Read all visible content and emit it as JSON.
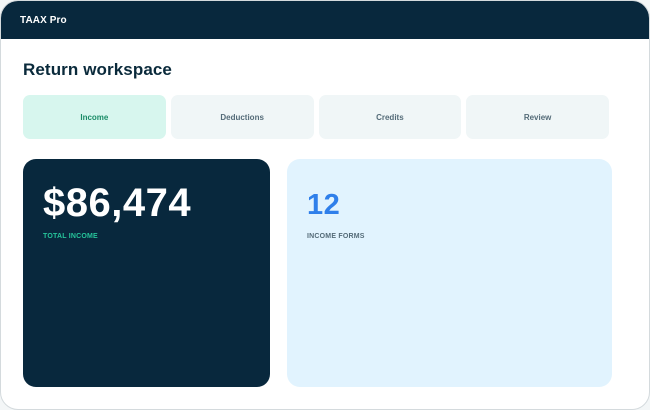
{
  "app": {
    "title": "TAAX Pro"
  },
  "page": {
    "title": "Return workspace"
  },
  "tabs": [
    {
      "label": "Income",
      "active": true
    },
    {
      "label": "Deductions",
      "active": false
    },
    {
      "label": "Credits",
      "active": false
    },
    {
      "label": "Review",
      "active": false
    }
  ],
  "cards": {
    "income": {
      "value": "$86,474",
      "label": "TOTAL INCOME"
    },
    "forms": {
      "value": "12",
      "label": "INCOME FORMS"
    }
  },
  "colors": {
    "navy": "#08283d",
    "accent_green": "#26c49b",
    "active_tab_bg": "#d7f6ee",
    "active_tab_text": "#1a8c67",
    "blue_value": "#2f7fea",
    "light_blue_card": "#e1f3fe"
  }
}
